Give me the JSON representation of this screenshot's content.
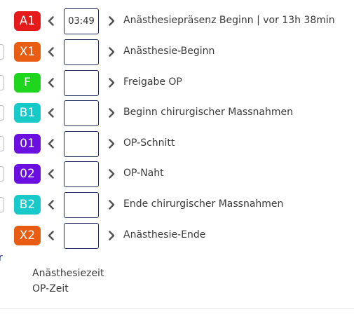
{
  "colors": {
    "red": "#e51b1b",
    "orange": "#e85d12",
    "green": "#1fd61f",
    "teal": "#18c9c9",
    "purple": "#6b0ee0",
    "box_border": "#1e2a5a"
  },
  "rows": [
    {
      "badge": "A1",
      "color": "#e51b1b",
      "time": "03:49",
      "label": "Anästhesiepräsenz Beginn | vor 13h 38min"
    },
    {
      "badge": "X1",
      "color": "#e85d12",
      "time": "",
      "label": "Anästhesie-Beginn"
    },
    {
      "badge": "F",
      "color": "#1fd61f",
      "time": "",
      "label": "Freigabe OP"
    },
    {
      "badge": "B1",
      "color": "#18c9c9",
      "time": "",
      "label": "Beginn chirurgischer Massnahmen"
    },
    {
      "badge": "01",
      "color": "#6b0ee0",
      "time": "",
      "label": "OP-Schnitt"
    },
    {
      "badge": "02",
      "color": "#6b0ee0",
      "time": "",
      "label": "OP-Naht"
    },
    {
      "badge": "B2",
      "color": "#18c9c9",
      "time": "",
      "label": "Ende chirurgischer Massnahmen"
    },
    {
      "badge": "X2",
      "color": "#e85d12",
      "time": "",
      "label": "Anästhesie-Ende"
    }
  ],
  "edge_text": "r",
  "summary": {
    "anesthesia_time_label": "Anästhesiezeit",
    "op_time_label": "OP-Zeit"
  },
  "icons": {
    "left": "chevron-left-icon",
    "right": "chevron-right-icon"
  }
}
